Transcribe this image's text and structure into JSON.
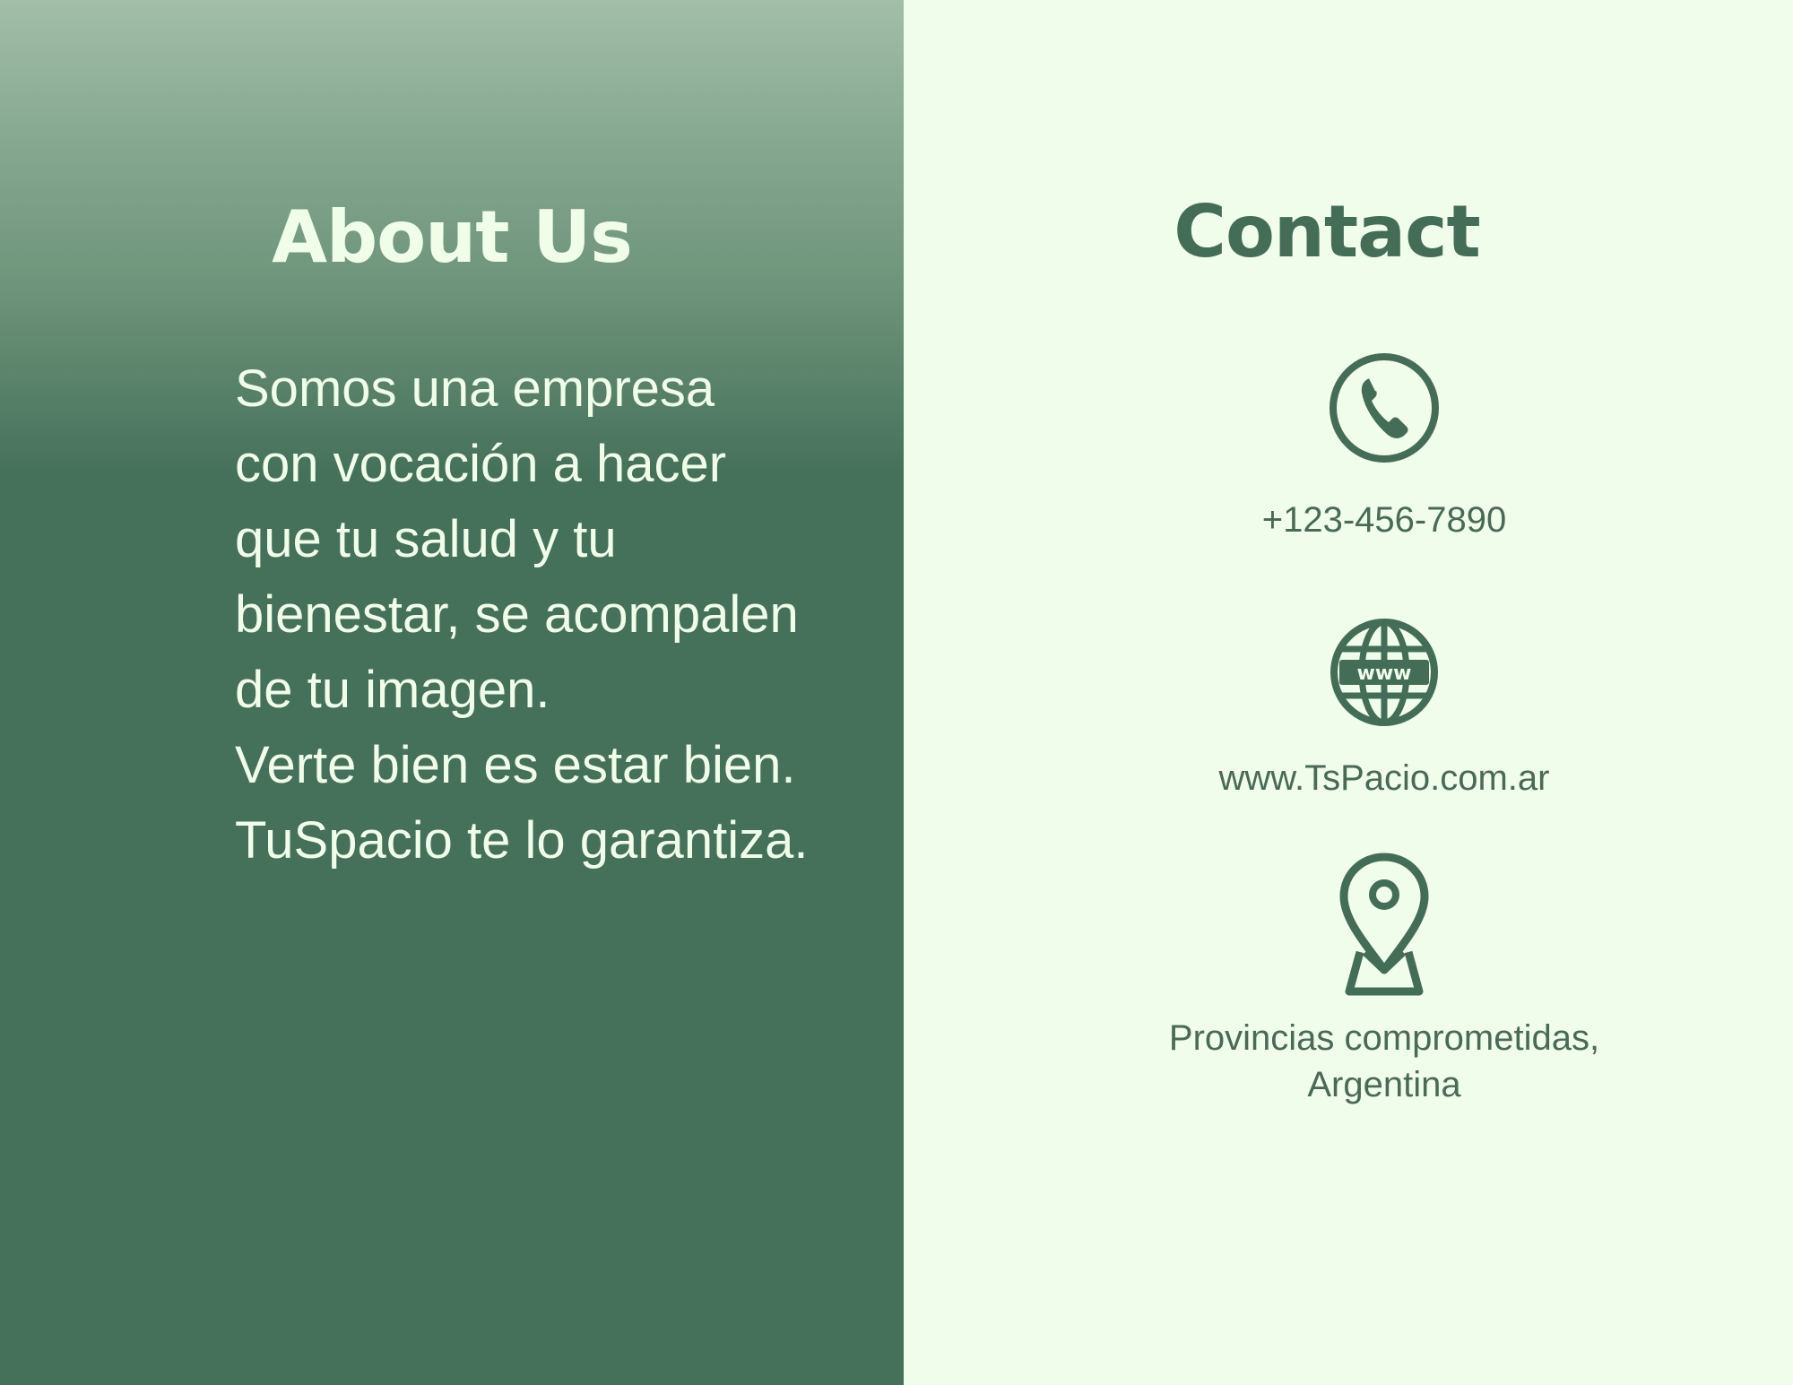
{
  "about": {
    "title": "About Us",
    "paragraphs": [
      "Somos una empresa con vocación a hacer que tu salud y tu bienestar, se acompalen de tu imagen.",
      "Verte bien es estar bien.",
      "TuSpacio te lo garantiza."
    ]
  },
  "contact": {
    "title": "Contact",
    "phone": {
      "icon": "phone-icon",
      "text": "+123-456-7890"
    },
    "website": {
      "icon": "globe-www-icon",
      "text": "www.TsPacio.com.ar"
    },
    "location": {
      "icon": "map-pin-icon",
      "text": "Provincias comprometidas, Argentina"
    }
  },
  "colors": {
    "dark_green": "#45705a",
    "light_green_bg": "#f0fdea",
    "light_text": "#f0fde9",
    "icon_green": "#446d58",
    "contact_text": "#4a6a58"
  }
}
